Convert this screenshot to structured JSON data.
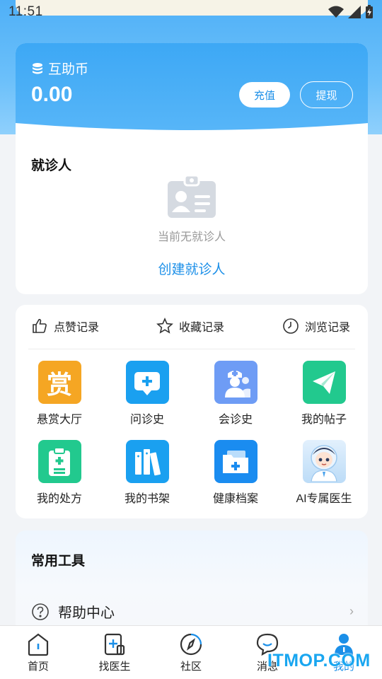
{
  "status_bar": {
    "time": "11:51"
  },
  "coin": {
    "label": "互助币",
    "value": "0.00",
    "recharge_label": "充值",
    "withdraw_label": "提现"
  },
  "patient": {
    "title": "就诊人",
    "empty_text": "当前无就诊人",
    "create_label": "创建就诊人"
  },
  "records": {
    "likes": "点赞记录",
    "favorites": "收藏记录",
    "history": "浏览记录"
  },
  "grid": [
    {
      "label": "悬赏大厅",
      "icon": "reward-icon",
      "color": "#f5a623"
    },
    {
      "label": "问诊史",
      "icon": "consult-chat-icon",
      "color": "#1aa0f0"
    },
    {
      "label": "会诊史",
      "icon": "doctors-group-icon",
      "color": "#6e9cf5"
    },
    {
      "label": "我的帖子",
      "icon": "paper-plane-icon",
      "color": "#22c98e"
    },
    {
      "label": "我的处方",
      "icon": "prescription-clipboard-icon",
      "color": "#22c98e"
    },
    {
      "label": "我的书架",
      "icon": "bookshelf-icon",
      "color": "#1aa0f0"
    },
    {
      "label": "健康档案",
      "icon": "health-folder-icon",
      "color": "#1a8cf0"
    },
    {
      "label": "AI专属医生",
      "icon": "ai-doctor-avatar-icon",
      "color": "#cfe6fb"
    }
  ],
  "tools": {
    "title": "常用工具",
    "help_label": "帮助中心"
  },
  "tabbar": {
    "tabs": [
      {
        "label": "首页",
        "icon": "home-icon"
      },
      {
        "label": "找医生",
        "icon": "find-doctor-icon"
      },
      {
        "label": "社区",
        "icon": "compass-icon"
      },
      {
        "label": "消息",
        "icon": "message-bubble-icon"
      },
      {
        "label": "我的",
        "icon": "user-icon"
      }
    ],
    "active_index": 4
  },
  "watermark": "ITMOP.COM",
  "colors": {
    "primary": "#1b8fe8",
    "header_bg": "#4fb0f7"
  }
}
